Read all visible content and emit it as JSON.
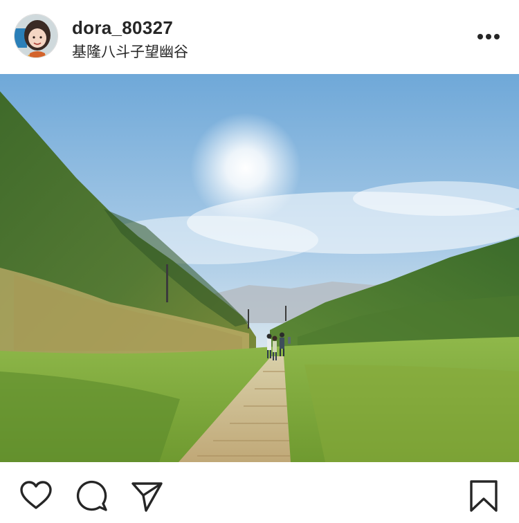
{
  "post": {
    "username": "dora_80327",
    "location": "基隆八斗子望幽谷"
  },
  "photo": {
    "subject": "grassy valley trail with hikers"
  },
  "icons": {
    "more": "more-options-icon",
    "like": "heart-icon",
    "comment": "comment-bubble-icon",
    "share": "paper-plane-icon",
    "save": "bookmark-icon"
  }
}
